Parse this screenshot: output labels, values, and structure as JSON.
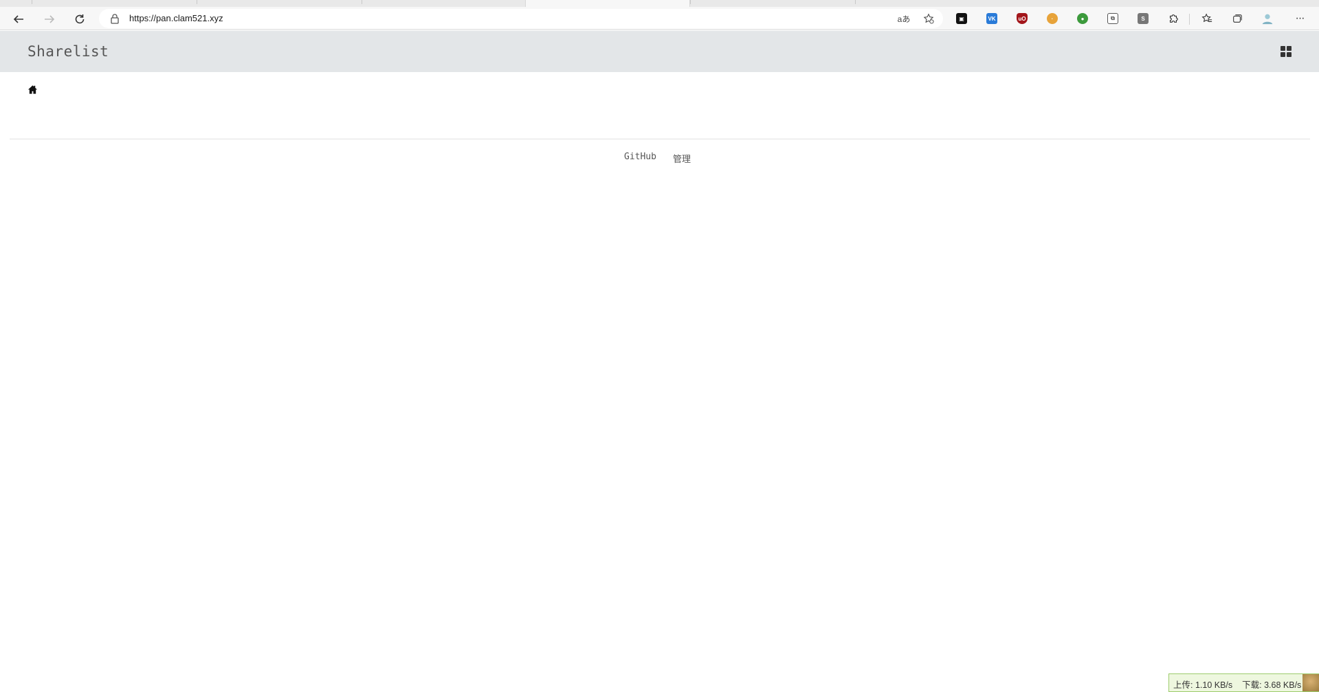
{
  "browser": {
    "url": "https://pan.clam521.xyz",
    "toolbar_icons": [
      "back-icon",
      "forward-icon",
      "refresh-icon",
      "lock-icon",
      "translate-icon",
      "add-favorite-icon"
    ],
    "extensions": [
      "extension-1-icon",
      "extension-vk-icon",
      "extension-ublock-icon",
      "extension-cookie-icon",
      "extension-globe-icon",
      "extension-copy-icon",
      "extension-s-icon",
      "extensions-puzzle-icon",
      "favorites-icon",
      "collections-icon",
      "profile-icon",
      "more-icon"
    ],
    "translate_label": "aあ",
    "more_label": "···"
  },
  "navbar": {
    "brand": "Sharelist"
  },
  "footer": {
    "github": "GitHub",
    "admin": "管理"
  },
  "status": {
    "upload": "上传: 1.10 KB/s",
    "download": "下载: 3.68 KB/s"
  },
  "colors": {
    "navbar_bg": "#e3e6e8",
    "brand_text": "#555555",
    "netspeed_bg": "#eef7df",
    "netspeed_border": "#9ccb6a"
  }
}
